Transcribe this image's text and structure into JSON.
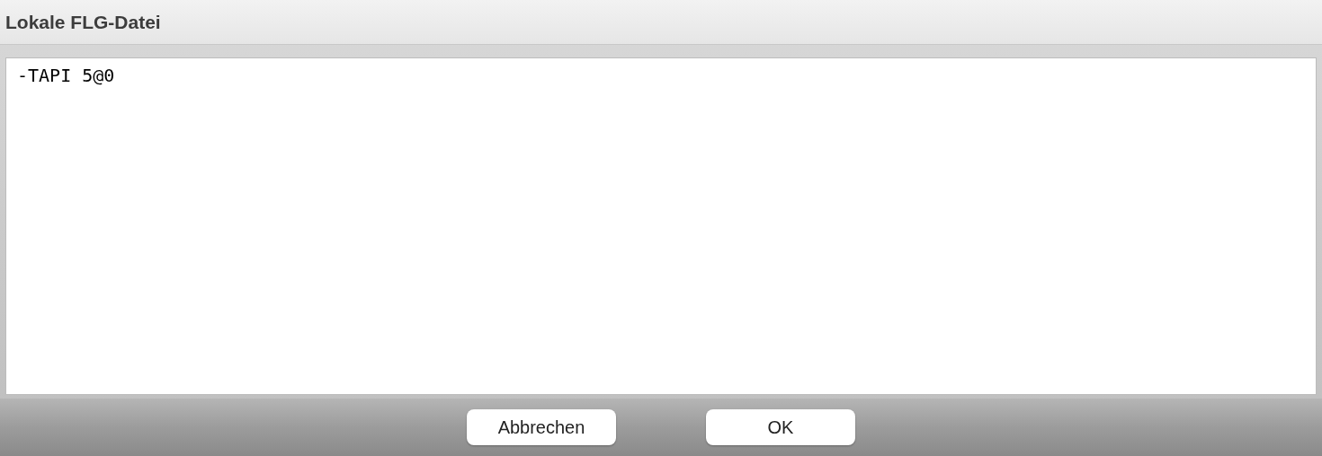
{
  "window": {
    "title": "Lokale FLG-Datei"
  },
  "editor": {
    "value": "-TAPI 5@0"
  },
  "buttons": [
    {
      "label": "Abbrechen"
    },
    {
      "label": "OK"
    }
  ]
}
